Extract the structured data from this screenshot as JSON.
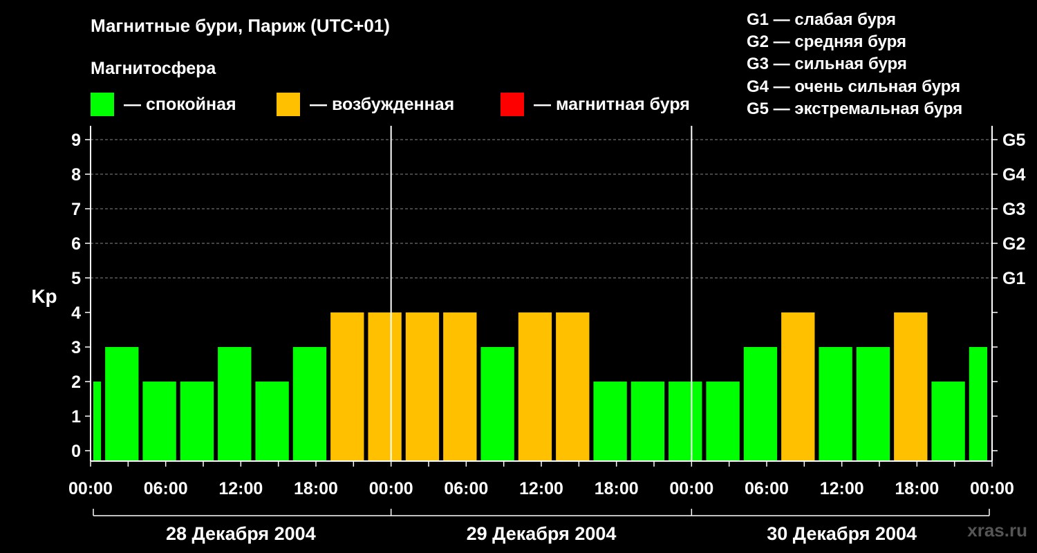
{
  "title": "Магнитные бури, Париж (UTC+01)",
  "subtitle": "Магнитосфера",
  "legend": [
    {
      "label": "— спокойная",
      "color": "#00ff00"
    },
    {
      "label": "— возбужденная",
      "color": "#ffc000"
    },
    {
      "label": "— магнитная буря",
      "color": "#ff0000"
    }
  ],
  "g_legend": [
    "G1 — слабая буря",
    "G2 — средняя буря",
    "G3 — сильная буря",
    "G4 — очень сильная буря",
    "G5 — экстремальная буря"
  ],
  "watermark": "xras.ru",
  "chart_data": {
    "type": "bar",
    "ylabel": "Kp",
    "ylim": [
      0,
      9
    ],
    "yticks": [
      "0",
      "1",
      "2",
      "3",
      "4",
      "5",
      "6",
      "7",
      "8",
      "9"
    ],
    "right_ticks": [
      {
        "kp": 5,
        "label": "G1"
      },
      {
        "kp": 6,
        "label": "G2"
      },
      {
        "kp": 7,
        "label": "G3"
      },
      {
        "kp": 8,
        "label": "G4"
      },
      {
        "kp": 9,
        "label": "G5"
      }
    ],
    "xticks": [
      "00:00",
      "06:00",
      "12:00",
      "18:00",
      "00:00",
      "06:00",
      "12:00",
      "18:00",
      "00:00",
      "06:00",
      "12:00",
      "18:00",
      "00:00"
    ],
    "days": [
      "28 Декабря 2004",
      "29 Декабря 2004",
      "30 Декабря 2004"
    ],
    "grid": "dashed horizontal at Kp 5–9",
    "colors": {
      "quiet": "#00ff00",
      "active": "#ffc000",
      "storm": "#ff0000"
    },
    "bars": [
      {
        "start": "28 Декабря 2004 00:00",
        "end": "28 Декабря 2004 01:00",
        "kp": 2
      },
      {
        "start": "28 Декабря 2004 01:00",
        "end": "28 Декабря 2004 04:00",
        "kp": 3
      },
      {
        "start": "28 Декабря 2004 04:00",
        "end": "28 Декабря 2004 07:00",
        "kp": 2
      },
      {
        "start": "28 Декабря 2004 07:00",
        "end": "28 Декабря 2004 10:00",
        "kp": 2
      },
      {
        "start": "28 Декабря 2004 10:00",
        "end": "28 Декабря 2004 13:00",
        "kp": 3
      },
      {
        "start": "28 Декабря 2004 13:00",
        "end": "28 Декабря 2004 16:00",
        "kp": 2
      },
      {
        "start": "28 Декабря 2004 16:00",
        "end": "28 Декабря 2004 19:00",
        "kp": 3
      },
      {
        "start": "28 Декабря 2004 19:00",
        "end": "28 Декабря 2004 22:00",
        "kp": 4
      },
      {
        "start": "28 Декабря 2004 22:00",
        "end": "29 Декабря 2004 01:00",
        "kp": 4
      },
      {
        "start": "29 Декабря 2004 01:00",
        "end": "29 Декабря 2004 04:00",
        "kp": 4
      },
      {
        "start": "29 Декабря 2004 04:00",
        "end": "29 Декабря 2004 07:00",
        "kp": 4
      },
      {
        "start": "29 Декабря 2004 07:00",
        "end": "29 Декабря 2004 10:00",
        "kp": 3
      },
      {
        "start": "29 Декабря 2004 10:00",
        "end": "29 Декабря 2004 13:00",
        "kp": 4
      },
      {
        "start": "29 Декабря 2004 13:00",
        "end": "29 Декабря 2004 16:00",
        "kp": 4
      },
      {
        "start": "29 Декабря 2004 16:00",
        "end": "29 Декабря 2004 19:00",
        "kp": 2
      },
      {
        "start": "29 Декабря 2004 19:00",
        "end": "29 Декабря 2004 22:00",
        "kp": 2
      },
      {
        "start": "29 Декабря 2004 22:00",
        "end": "30 Декабря 2004 01:00",
        "kp": 2
      },
      {
        "start": "30 Декабря 2004 01:00",
        "end": "30 Декабря 2004 04:00",
        "kp": 2
      },
      {
        "start": "30 Декабря 2004 04:00",
        "end": "30 Декабря 2004 07:00",
        "kp": 3
      },
      {
        "start": "30 Декабря 2004 07:00",
        "end": "30 Декабря 2004 10:00",
        "kp": 4
      },
      {
        "start": "30 Декабря 2004 10:00",
        "end": "30 Декабря 2004 13:00",
        "kp": 3
      },
      {
        "start": "30 Декабря 2004 13:00",
        "end": "30 Декабря 2004 16:00",
        "kp": 3
      },
      {
        "start": "30 Декабря 2004 16:00",
        "end": "30 Декабря 2004 19:00",
        "kp": 4
      },
      {
        "start": "30 Декабря 2004 19:00",
        "end": "30 Декабря 2004 22:00",
        "kp": 2
      },
      {
        "start": "30 Декабря 2004 22:00",
        "end": "31 Декабря 2004 00:00",
        "kp": 3
      }
    ]
  }
}
